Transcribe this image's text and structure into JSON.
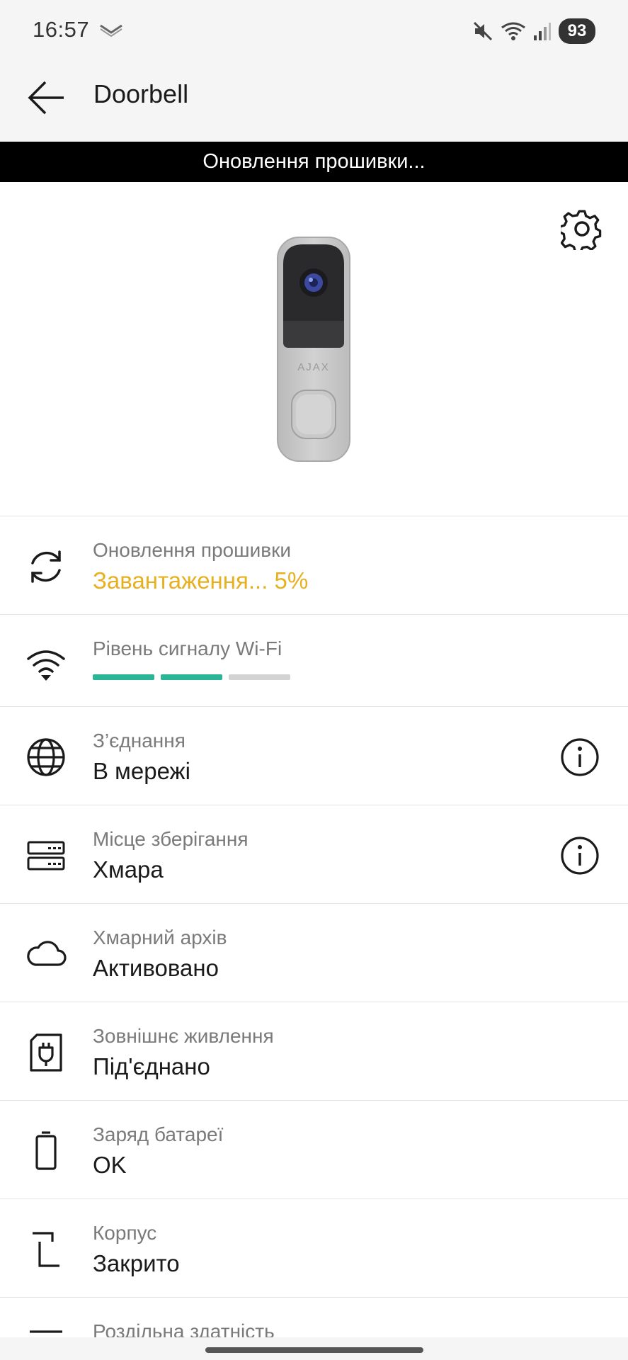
{
  "status_bar": {
    "time": "16:57",
    "battery": "93"
  },
  "app_bar": {
    "title": "Doorbell"
  },
  "banner": {
    "text": "Оновлення прошивки..."
  },
  "device": {
    "brand": "AJAX"
  },
  "colors": {
    "accent": "#e6b020",
    "signal_on": "#2bb597",
    "signal_off": "#d3d3d3"
  },
  "rows": [
    {
      "icon": "sync-icon",
      "label": "Оновлення прошивки",
      "value": "Завантаження... 5%"
    },
    {
      "icon": "wifi-icon",
      "label": "Рівень сигналу Wi-Fi",
      "signal_level": 2,
      "signal_max": 3
    },
    {
      "icon": "globe-icon",
      "label": "З’єднання",
      "value": "В мережі",
      "has_info": true
    },
    {
      "icon": "storage-icon",
      "label": "Місце зберігання",
      "value": "Хмара",
      "has_info": true
    },
    {
      "icon": "cloud-icon",
      "label": "Хмарний архів",
      "value": "Активовано"
    },
    {
      "icon": "power-plug-icon",
      "label": "Зовнішнє живлення",
      "value": "Під'єднано"
    },
    {
      "icon": "battery-icon",
      "label": "Заряд батареї",
      "value": "OK"
    },
    {
      "icon": "tamper-icon",
      "label": "Корпус",
      "value": "Закрито"
    },
    {
      "icon": "resolution-icon",
      "label": "Роздільна здатність"
    }
  ]
}
